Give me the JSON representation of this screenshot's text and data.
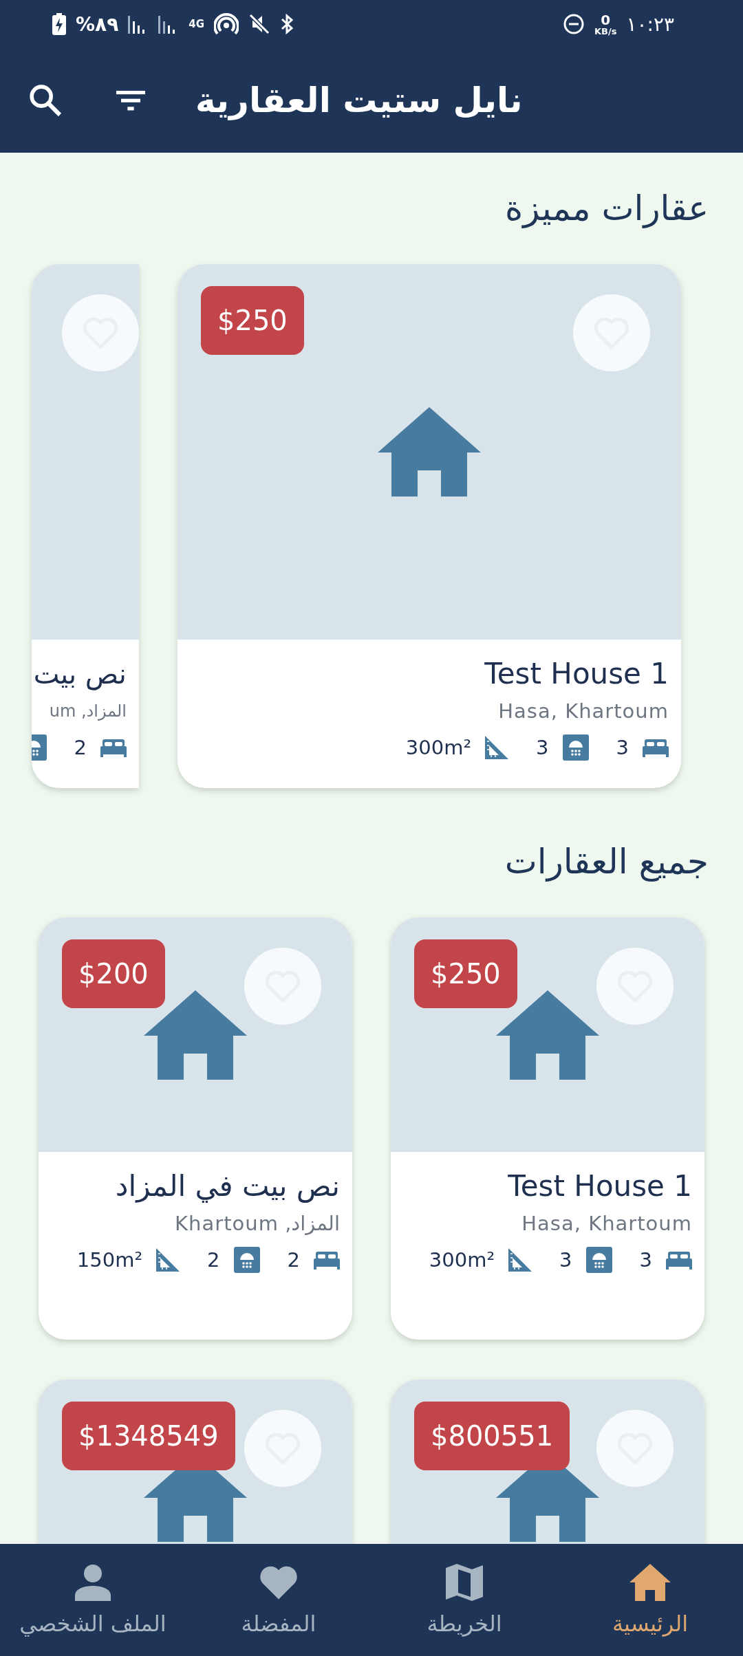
{
  "status_bar": {
    "battery": "%٨٩",
    "network": "4G",
    "speed": "0",
    "speed_unit": "KB/s",
    "time": "١٠:٢٣"
  },
  "app_bar": {
    "title": "نايل ستيت العقارية"
  },
  "featured": {
    "title": "عقارات مميزة",
    "cards": [
      {
        "price": "$250",
        "favorite": false,
        "title": "Test House 1",
        "location": "Hasa, Khartoum",
        "specs": [
          {
            "kind": "beds",
            "value": "3"
          },
          {
            "kind": "baths",
            "value": "3"
          },
          {
            "kind": "area",
            "value": "300m²"
          }
        ]
      },
      {
        "title": "نص بيت",
        "location": "المزاد, um",
        "specs": [
          {
            "kind": "beds",
            "value": "2"
          },
          {
            "kind": "baths"
          }
        ]
      }
    ]
  },
  "all": {
    "title": "جميع العقارات",
    "cards": [
      {
        "price": "$250",
        "favorite": false,
        "title": "Test House 1",
        "location": "Hasa, Khartoum",
        "specs": [
          {
            "kind": "beds",
            "value": "3"
          },
          {
            "kind": "baths",
            "value": "3"
          },
          {
            "kind": "area",
            "value": "300m²"
          }
        ]
      },
      {
        "price": "$200",
        "favorite": false,
        "title": "نص بيت في المزاد",
        "location": "المزاد, Khartoum",
        "specs": [
          {
            "kind": "beds",
            "value": "2"
          },
          {
            "kind": "baths",
            "value": "2"
          },
          {
            "kind": "area",
            "value": "150m²"
          }
        ]
      },
      {
        "price": "$800551",
        "favorite": false
      },
      {
        "price": "$1348549",
        "favorite": false
      }
    ]
  },
  "nav": [
    {
      "kind": "home",
      "label": "الرئيسية",
      "selected": true
    },
    {
      "kind": "map",
      "label": "الخريطة",
      "selected": false
    },
    {
      "kind": "favorites",
      "label": "المفضلة",
      "selected": false
    },
    {
      "kind": "profile",
      "label": "الملف الشخصي",
      "selected": false
    }
  ]
}
